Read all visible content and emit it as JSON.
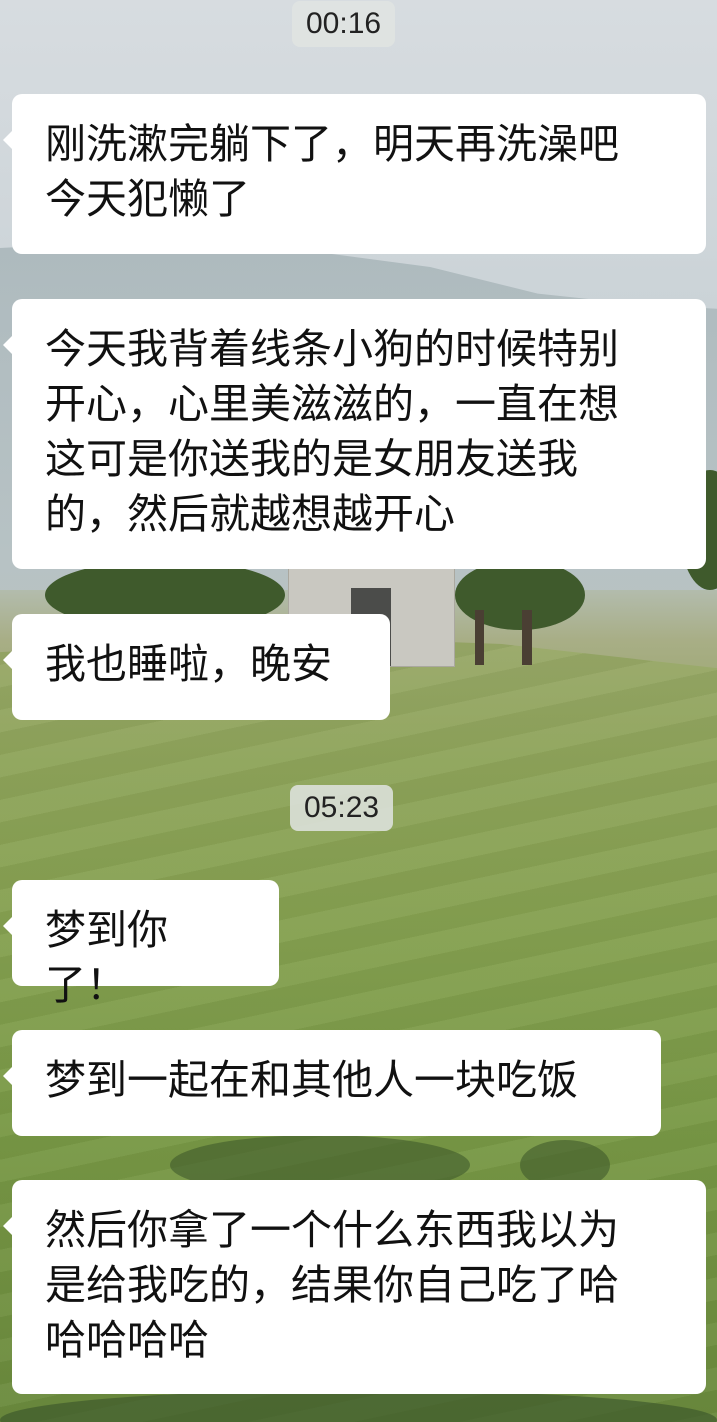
{
  "timestamps": [
    "00:16",
    "05:23"
  ],
  "messages": [
    {
      "text": "刚洗漱完躺下了，明天再洗澡吧\n今天犯懒了"
    },
    {
      "text": "今天我背着线条小狗的时候特别\n开心，心里美滋滋的，一直在想\n这可是你送我的是女朋友送我\n的，然后就越想越开心"
    },
    {
      "text": "我也睡啦，晚安"
    },
    {
      "text": "梦到你了！"
    },
    {
      "text": "梦到一起在和其他人一块吃饭"
    },
    {
      "text": "然后你拿了一个什么东西我以为\n是给我吃的，结果你自己吃了哈\n哈哈哈哈"
    }
  ],
  "colors": {
    "bubble": "#ffffff",
    "timestamp_bg": "#e1e4e2",
    "text": "#111111"
  }
}
